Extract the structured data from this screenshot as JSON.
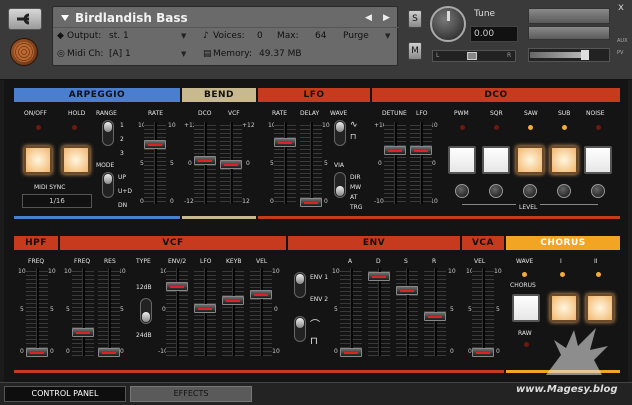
{
  "header": {
    "instrument_name": "Birdlandish Bass",
    "output_label": "Output:",
    "output_value": "st. 1",
    "voices_label": "Voices:",
    "voices_value": "0",
    "max_label": "Max:",
    "max_value": "64",
    "purge_label": "Purge",
    "midi_label": "Midi Ch:",
    "midi_value": "[A] 1",
    "memory_label": "Memory:",
    "memory_value": "49.37 MB",
    "s_label": "S",
    "m_label": "M",
    "tune_label": "Tune",
    "tune_value": "0.00",
    "pan_l": "L",
    "pan_r": "R",
    "close": "x",
    "aux": "AUX",
    "pv": "PV"
  },
  "sections": {
    "arpeggio": "ARPEGGIO",
    "bend": "BEND",
    "lfo": "LFO",
    "dco": "DCO",
    "hpf": "HPF",
    "vcf": "VCF",
    "env": "ENV",
    "vca": "VCA",
    "chorus": "CHORUS"
  },
  "arpeggio": {
    "onoff": "ON/OFF",
    "hold": "HOLD",
    "range": "RANGE",
    "rate": "RATE",
    "r1": "1",
    "r2": "2",
    "r3": "3",
    "mode": "MODE",
    "up": "UP",
    "ud": "U+D",
    "dn": "DN",
    "midi_sync": "MIDI SYNC",
    "sync_value": "1/16",
    "t10": "10",
    "t5": "5",
    "t0": "0"
  },
  "bend": {
    "dco": "DCO",
    "vcf": "VCF",
    "p12a": "+12",
    "p12b": "+12",
    "z0a": "0",
    "z0b": "0",
    "m12a": "-12",
    "m12b": "-12"
  },
  "lfo": {
    "rate": "RATE",
    "delay": "DELAY",
    "wave": "WAVE",
    "via": "VIA",
    "dir": "DIR",
    "mw": "MW",
    "at": "AT",
    "trg": "TRG",
    "t10a": "10",
    "t10b": "10",
    "t5a": "5",
    "t5b": "5",
    "t0a": "0",
    "t0b": "0"
  },
  "dco": {
    "detune": "DETUNE",
    "lfo": "LFO",
    "pwm": "PWM",
    "sqr": "SQR",
    "saw": "SAW",
    "sub": "SUB",
    "noise": "NOISE",
    "level": "LEVEL",
    "p10": "+10",
    "p10b": "10",
    "z0": "0",
    "z0b": "0",
    "m10": "-10",
    "m10b": "-10"
  },
  "hpf": {
    "freq": "FREQ",
    "t10": "10",
    "t5": "5",
    "t0": "0"
  },
  "vcf": {
    "freq": "FREQ",
    "res": "RES",
    "type": "TYPE",
    "env2": "ENV/2",
    "lfo": "LFO",
    "keyb": "KEYB",
    "vel": "VEL",
    "db12": "12dB",
    "db24": "24dB",
    "t10": "10",
    "t10b": "10",
    "t5": "5",
    "t5b": "5",
    "t0": "0",
    "t0b": "0",
    "z0": "0",
    "m10": "-10"
  },
  "env": {
    "env1": "ENV 1",
    "env2": "ENV 2",
    "a": "A",
    "d": "D",
    "s": "S",
    "r": "R",
    "t10": "10",
    "t10b": "10",
    "t5": "5",
    "t5b": "5",
    "t0": "0",
    "t0b": "0"
  },
  "vca": {
    "vel": "VEL",
    "t10": "10",
    "t5": "5",
    "t0": "0"
  },
  "chorus": {
    "wave": "WAVE",
    "i": "I",
    "ii": "II",
    "chorus": "CHORUS",
    "raw": "RAW"
  },
  "tabs": {
    "control_panel": "CONTROL PANEL",
    "effects": "EFFECTS"
  },
  "watermark": "www.Magesy.blog",
  "colors": {
    "arpeggio": "#4a7fd0",
    "bend": "#c9b98e",
    "red": "#c63a1e",
    "chorus": "#f2a423",
    "button": "#f2b56a"
  }
}
